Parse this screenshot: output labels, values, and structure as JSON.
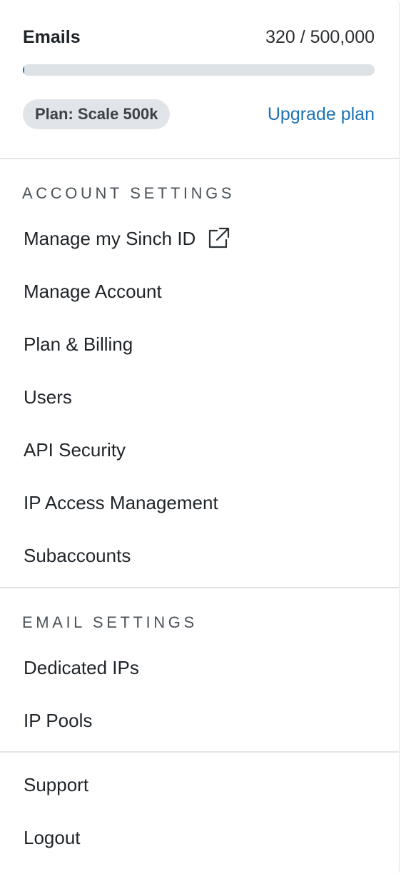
{
  "usage": {
    "title": "Emails",
    "count_text": "320 / 500,000",
    "used": 320,
    "limit": 500000,
    "progress_fraction": 0.00064,
    "plan_badge": "Plan: Scale 500k",
    "upgrade_label": "Upgrade plan"
  },
  "account_settings": {
    "title": "ACCOUNT SETTINGS",
    "items": [
      {
        "label": "Manage my Sinch ID",
        "icon": "external-link-icon"
      },
      {
        "label": "Manage Account"
      },
      {
        "label": "Plan & Billing"
      },
      {
        "label": "Users"
      },
      {
        "label": "API Security"
      },
      {
        "label": "IP Access Management"
      },
      {
        "label": "Subaccounts"
      }
    ]
  },
  "email_settings": {
    "title": "EMAIL SETTINGS",
    "items": [
      {
        "label": "Dedicated IPs"
      },
      {
        "label": "IP Pools"
      }
    ]
  },
  "footer_menu": {
    "items": [
      {
        "label": "Support"
      },
      {
        "label": "Logout"
      }
    ]
  },
  "colors": {
    "accent": "#1d73b3",
    "progress_track": "#dde2e6",
    "badge_bg": "#e1e5e9",
    "divider": "#e2e5e8"
  }
}
